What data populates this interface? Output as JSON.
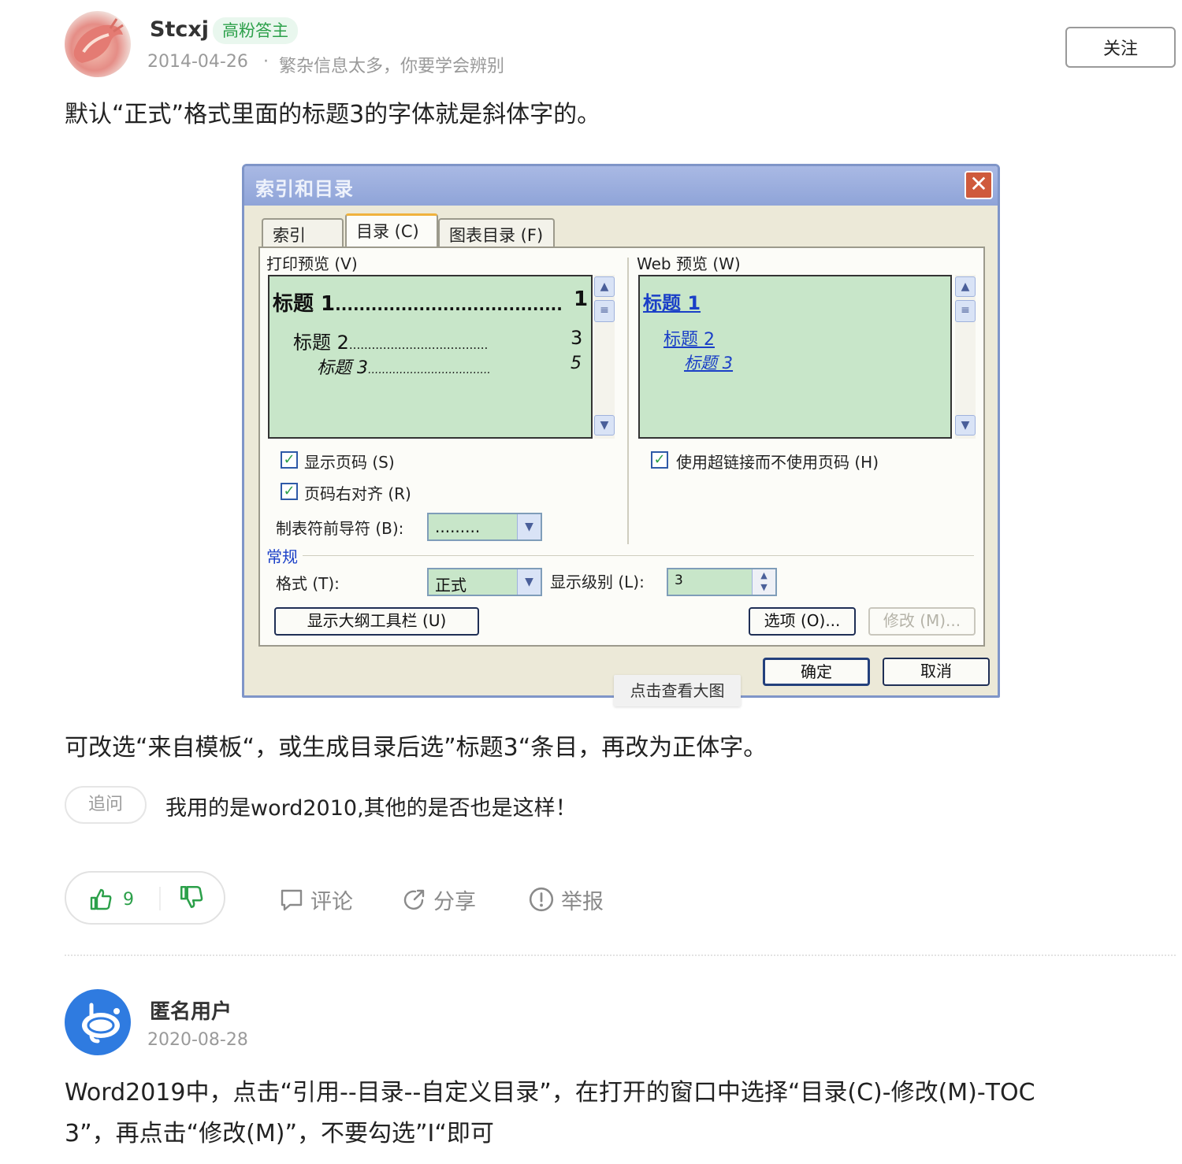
{
  "answer1": {
    "username": "Stcxj",
    "badge": "高粉答主",
    "date": "2014-04-26",
    "separator": "·",
    "signature": "繁杂信息太多，你要学会辨别",
    "follow_label": "关注",
    "text1": "默认“正式”格式里面的标题3的字体就是斜体字的。",
    "text2": "可改选“来自模板“，或生成目录后选”标题3“条目，再改为正体字。",
    "image_tooltip": "点击查看大图",
    "followup_tag": "追问",
    "followup_text": "我用的是word2010,其他的是否也是这样！",
    "like_count": "9",
    "actions": {
      "comment": "评论",
      "share": "分享",
      "report": "举报"
    }
  },
  "dialog": {
    "title": "索引和目录",
    "close": "✕",
    "tabs": [
      "索引 (X)",
      "目录 (C)",
      "图表目录 (F)"
    ],
    "print_preview_label": "打印预览 (V)",
    "web_preview_label": "Web 预览 (W)",
    "print_items": [
      {
        "text": "标题 1",
        "dots": "......................................",
        "page": "1"
      },
      {
        "text": "标题 2",
        "dots": ".....................................",
        "page": "3"
      },
      {
        "text": "标题 3",
        "dots": "...................................",
        "page": "5"
      }
    ],
    "web_items": [
      "标题 1",
      "标题 2",
      "标题 3"
    ],
    "show_page_numbers": "显示页码 (S)",
    "right_align": "页码右对齐 (R)",
    "use_hyperlinks": "使用超链接而不使用页码 (H)",
    "tab_leader_label": "制表符前导符 (B):",
    "tab_leader_value": ".........",
    "general_label": "常规",
    "format_label": "格式 (T):",
    "format_value": "正式",
    "levels_label": "显示级别 (L):",
    "levels_value": "3",
    "outline_button": "显示大纲工具栏 (U)",
    "options_button": "选项 (O)...",
    "modify_button": "修改 (M)...",
    "ok_button": "确定",
    "cancel_button": "取消"
  },
  "answer2": {
    "username": "匿名用户",
    "date": "2020-08-28",
    "text_line1": "Word2019中，点击“引用--目录--自定义目录”，在打开的窗口中选择“目录(C)-修改(M)-TOC",
    "text_line2": "3”，再点击“修改(M)”，不要勾选”I“即可"
  },
  "colors": {
    "accent_green": "#2ca04a",
    "preview_green": "#c8e6c9",
    "link_blue": "#1a3fc7"
  }
}
